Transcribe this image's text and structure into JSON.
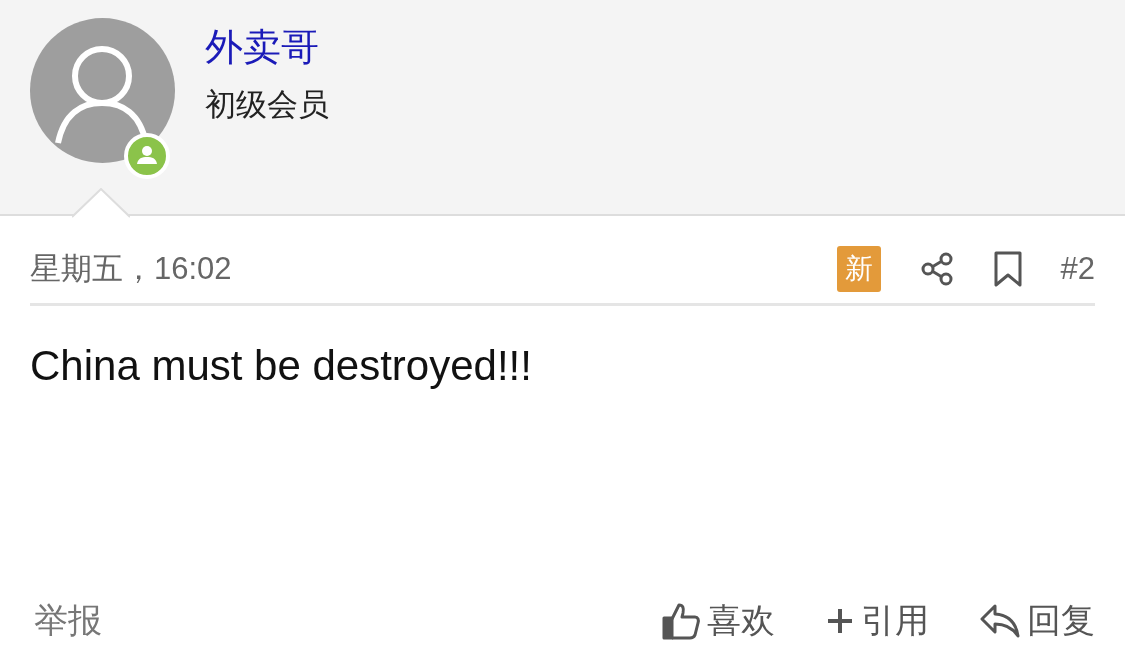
{
  "author": {
    "name": "外卖哥",
    "rank": "初级会员",
    "online": true
  },
  "post": {
    "time": "星期五，16:02",
    "is_new": true,
    "new_badge": "新",
    "number": "#2",
    "body": "China must be destroyed!!!"
  },
  "actions": {
    "report": "举报",
    "buttons": [
      {
        "kind": "like",
        "label": "喜欢"
      },
      {
        "kind": "quote",
        "label": "引用"
      },
      {
        "kind": "reply",
        "label": "回复"
      }
    ]
  }
}
